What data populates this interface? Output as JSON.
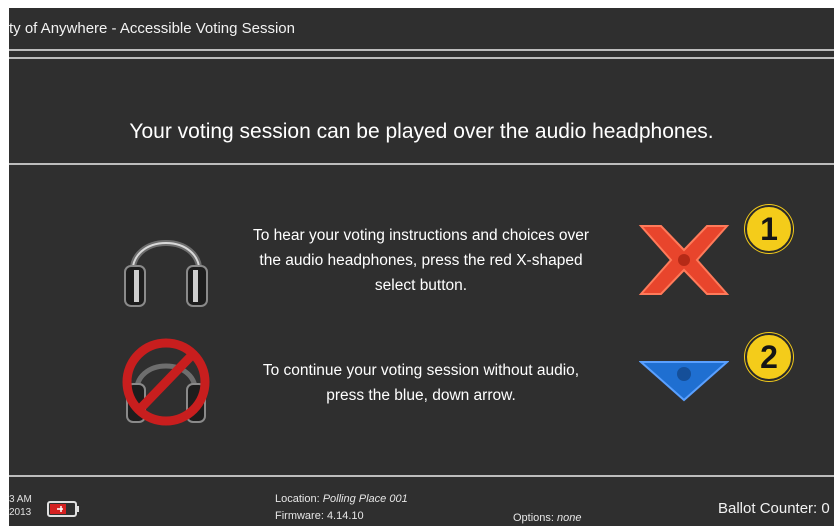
{
  "titlebar": {
    "title": "ty of Anywhere - Accessible Voting Session"
  },
  "main": {
    "heading": "Your voting session can be played over the audio headphones.",
    "option1": {
      "line1": "To hear your voting instructions and choices over",
      "line2": "the audio headphones, press the red X-shaped",
      "line3": "select button.",
      "badge": "1",
      "button_icon": "red-x-select-button-icon",
      "icon": "headphones-icon"
    },
    "option2": {
      "line1": "To continue your voting session without audio,",
      "line2": "press the blue, down arrow.",
      "badge": "2",
      "button_icon": "blue-down-arrow-button-icon",
      "icon": "no-headphones-icon"
    }
  },
  "footer": {
    "time": "3 AM",
    "year": "2013",
    "battery_icon": "battery-plug-icon",
    "location_label": "Location: ",
    "location_value": "Polling Place 001",
    "firmware_label": "Firmware: 4.14.10",
    "options_label": "Options: ",
    "options_value": "none",
    "ballot_counter": "Ballot Counter: 0"
  },
  "colors": {
    "background": "#2f2f2f",
    "x_button": "#e8452c",
    "arrow_button": "#1f6fd1",
    "badge": "#f4cc1a",
    "prohibit": "#c81e1e"
  }
}
